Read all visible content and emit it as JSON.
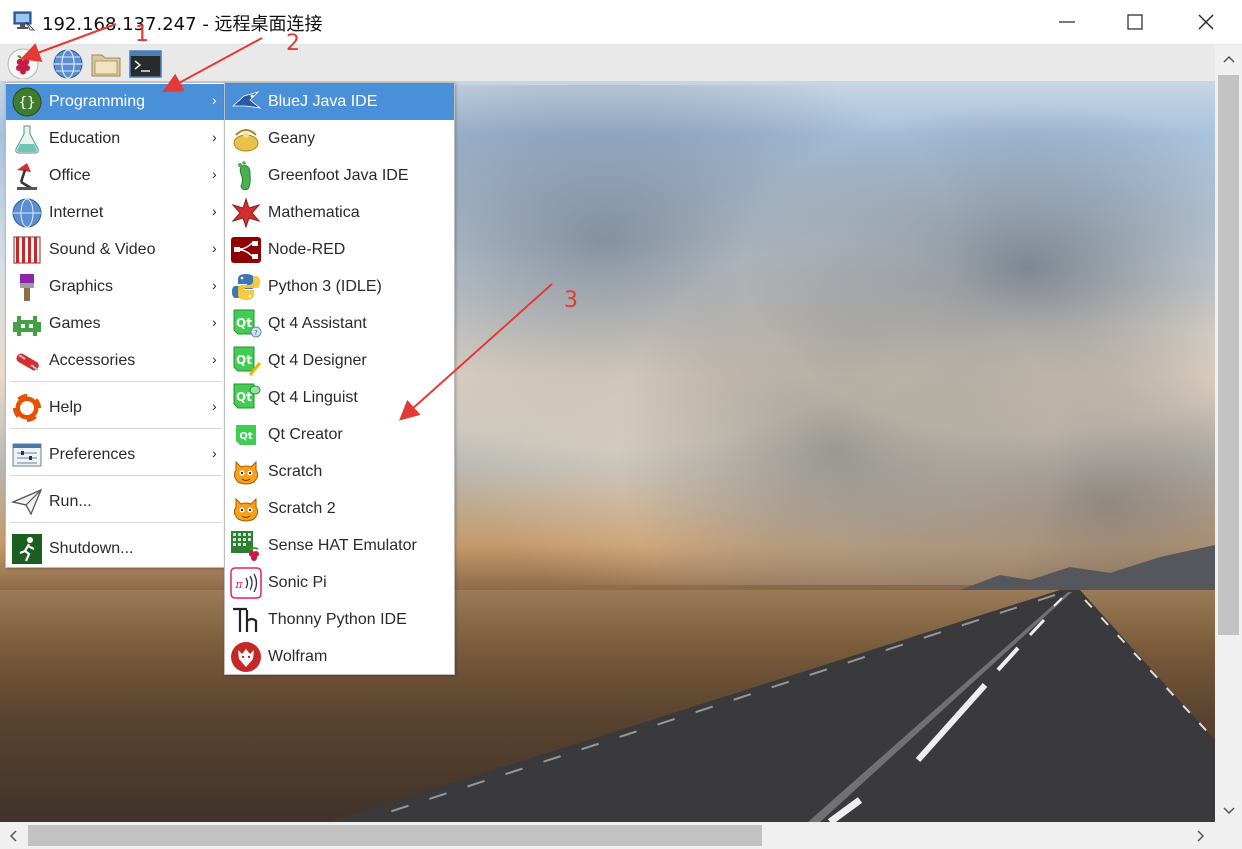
{
  "window": {
    "title": "192.168.137.247 - 远程桌面连接",
    "icon": "remote-desktop-icon",
    "controls": [
      "minimize-icon",
      "maximize-icon",
      "close-icon"
    ]
  },
  "panel": {
    "buttons": [
      "raspberry-menu-icon",
      "web-browser-icon",
      "file-manager-icon",
      "terminal-icon"
    ]
  },
  "main_menu": {
    "items": [
      {
        "label": "Programming",
        "icon": "programming-icon",
        "submenu": true,
        "active": true
      },
      {
        "label": "Education",
        "icon": "education-icon",
        "submenu": true
      },
      {
        "label": "Office",
        "icon": "office-icon",
        "submenu": true
      },
      {
        "label": "Internet",
        "icon": "internet-icon",
        "submenu": true
      },
      {
        "label": "Sound & Video",
        "icon": "sound-video-icon",
        "submenu": true
      },
      {
        "label": "Graphics",
        "icon": "graphics-icon",
        "submenu": true
      },
      {
        "label": "Games",
        "icon": "games-icon",
        "submenu": true
      },
      {
        "label": "Accessories",
        "icon": "accessories-icon",
        "submenu": true
      },
      {
        "label": "Help",
        "icon": "help-icon",
        "submenu": true
      },
      {
        "label": "Preferences",
        "icon": "preferences-icon",
        "submenu": true
      },
      {
        "label": "Run...",
        "icon": "run-icon",
        "submenu": false
      },
      {
        "label": "Shutdown...",
        "icon": "shutdown-icon",
        "submenu": false
      }
    ],
    "submenu_arrow": "›"
  },
  "programming_menu": {
    "items": [
      {
        "label": "BlueJ Java IDE",
        "icon": "bluej-icon",
        "active": true
      },
      {
        "label": "Geany",
        "icon": "geany-icon"
      },
      {
        "label": "Greenfoot Java IDE",
        "icon": "greenfoot-icon"
      },
      {
        "label": "Mathematica",
        "icon": "mathematica-icon"
      },
      {
        "label": "Node-RED",
        "icon": "node-red-icon"
      },
      {
        "label": "Python 3 (IDLE)",
        "icon": "python-icon"
      },
      {
        "label": "Qt 4 Assistant",
        "icon": "qt-assistant-icon"
      },
      {
        "label": "Qt 4 Designer",
        "icon": "qt-designer-icon"
      },
      {
        "label": "Qt 4 Linguist",
        "icon": "qt-linguist-icon"
      },
      {
        "label": "Qt Creator",
        "icon": "qt-creator-icon"
      },
      {
        "label": "Scratch",
        "icon": "scratch-icon"
      },
      {
        "label": "Scratch 2",
        "icon": "scratch2-icon"
      },
      {
        "label": "Sense HAT Emulator",
        "icon": "sense-hat-icon"
      },
      {
        "label": "Sonic Pi",
        "icon": "sonic-pi-icon"
      },
      {
        "label": "Thonny Python IDE",
        "icon": "thonny-icon"
      },
      {
        "label": "Wolfram",
        "icon": "wolfram-icon"
      }
    ]
  },
  "annotations": {
    "marks": [
      "1",
      "2",
      "3"
    ],
    "color": "#e53935"
  },
  "colors": {
    "menu_highlight": "#4a90d9",
    "panel": "#e9e9e9"
  }
}
